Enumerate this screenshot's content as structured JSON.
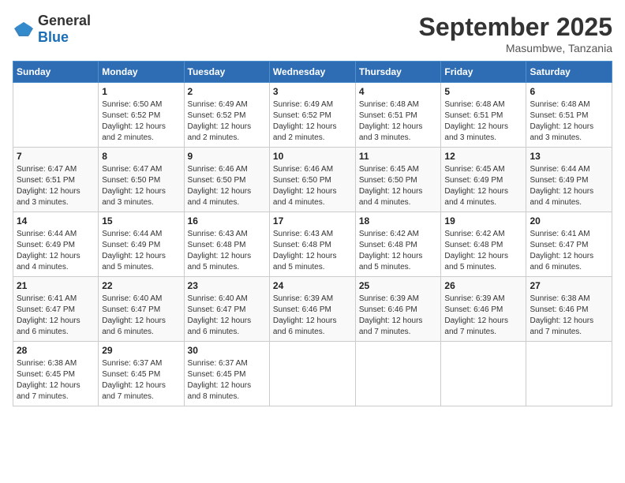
{
  "logo": {
    "general": "General",
    "blue": "Blue"
  },
  "header": {
    "month": "September 2025",
    "location": "Masumbwe, Tanzania"
  },
  "weekdays": [
    "Sunday",
    "Monday",
    "Tuesday",
    "Wednesday",
    "Thursday",
    "Friday",
    "Saturday"
  ],
  "weeks": [
    [
      {
        "day": "",
        "info": ""
      },
      {
        "day": "1",
        "info": "Sunrise: 6:50 AM\nSunset: 6:52 PM\nDaylight: 12 hours\nand 2 minutes."
      },
      {
        "day": "2",
        "info": "Sunrise: 6:49 AM\nSunset: 6:52 PM\nDaylight: 12 hours\nand 2 minutes."
      },
      {
        "day": "3",
        "info": "Sunrise: 6:49 AM\nSunset: 6:52 PM\nDaylight: 12 hours\nand 2 minutes."
      },
      {
        "day": "4",
        "info": "Sunrise: 6:48 AM\nSunset: 6:51 PM\nDaylight: 12 hours\nand 3 minutes."
      },
      {
        "day": "5",
        "info": "Sunrise: 6:48 AM\nSunset: 6:51 PM\nDaylight: 12 hours\nand 3 minutes."
      },
      {
        "day": "6",
        "info": "Sunrise: 6:48 AM\nSunset: 6:51 PM\nDaylight: 12 hours\nand 3 minutes."
      }
    ],
    [
      {
        "day": "7",
        "info": "Sunrise: 6:47 AM\nSunset: 6:51 PM\nDaylight: 12 hours\nand 3 minutes."
      },
      {
        "day": "8",
        "info": "Sunrise: 6:47 AM\nSunset: 6:50 PM\nDaylight: 12 hours\nand 3 minutes."
      },
      {
        "day": "9",
        "info": "Sunrise: 6:46 AM\nSunset: 6:50 PM\nDaylight: 12 hours\nand 4 minutes."
      },
      {
        "day": "10",
        "info": "Sunrise: 6:46 AM\nSunset: 6:50 PM\nDaylight: 12 hours\nand 4 minutes."
      },
      {
        "day": "11",
        "info": "Sunrise: 6:45 AM\nSunset: 6:50 PM\nDaylight: 12 hours\nand 4 minutes."
      },
      {
        "day": "12",
        "info": "Sunrise: 6:45 AM\nSunset: 6:49 PM\nDaylight: 12 hours\nand 4 minutes."
      },
      {
        "day": "13",
        "info": "Sunrise: 6:44 AM\nSunset: 6:49 PM\nDaylight: 12 hours\nand 4 minutes."
      }
    ],
    [
      {
        "day": "14",
        "info": "Sunrise: 6:44 AM\nSunset: 6:49 PM\nDaylight: 12 hours\nand 4 minutes."
      },
      {
        "day": "15",
        "info": "Sunrise: 6:44 AM\nSunset: 6:49 PM\nDaylight: 12 hours\nand 5 minutes."
      },
      {
        "day": "16",
        "info": "Sunrise: 6:43 AM\nSunset: 6:48 PM\nDaylight: 12 hours\nand 5 minutes."
      },
      {
        "day": "17",
        "info": "Sunrise: 6:43 AM\nSunset: 6:48 PM\nDaylight: 12 hours\nand 5 minutes."
      },
      {
        "day": "18",
        "info": "Sunrise: 6:42 AM\nSunset: 6:48 PM\nDaylight: 12 hours\nand 5 minutes."
      },
      {
        "day": "19",
        "info": "Sunrise: 6:42 AM\nSunset: 6:48 PM\nDaylight: 12 hours\nand 5 minutes."
      },
      {
        "day": "20",
        "info": "Sunrise: 6:41 AM\nSunset: 6:47 PM\nDaylight: 12 hours\nand 6 minutes."
      }
    ],
    [
      {
        "day": "21",
        "info": "Sunrise: 6:41 AM\nSunset: 6:47 PM\nDaylight: 12 hours\nand 6 minutes."
      },
      {
        "day": "22",
        "info": "Sunrise: 6:40 AM\nSunset: 6:47 PM\nDaylight: 12 hours\nand 6 minutes."
      },
      {
        "day": "23",
        "info": "Sunrise: 6:40 AM\nSunset: 6:47 PM\nDaylight: 12 hours\nand 6 minutes."
      },
      {
        "day": "24",
        "info": "Sunrise: 6:39 AM\nSunset: 6:46 PM\nDaylight: 12 hours\nand 6 minutes."
      },
      {
        "day": "25",
        "info": "Sunrise: 6:39 AM\nSunset: 6:46 PM\nDaylight: 12 hours\nand 7 minutes."
      },
      {
        "day": "26",
        "info": "Sunrise: 6:39 AM\nSunset: 6:46 PM\nDaylight: 12 hours\nand 7 minutes."
      },
      {
        "day": "27",
        "info": "Sunrise: 6:38 AM\nSunset: 6:46 PM\nDaylight: 12 hours\nand 7 minutes."
      }
    ],
    [
      {
        "day": "28",
        "info": "Sunrise: 6:38 AM\nSunset: 6:45 PM\nDaylight: 12 hours\nand 7 minutes."
      },
      {
        "day": "29",
        "info": "Sunrise: 6:37 AM\nSunset: 6:45 PM\nDaylight: 12 hours\nand 7 minutes."
      },
      {
        "day": "30",
        "info": "Sunrise: 6:37 AM\nSunset: 6:45 PM\nDaylight: 12 hours\nand 8 minutes."
      },
      {
        "day": "",
        "info": ""
      },
      {
        "day": "",
        "info": ""
      },
      {
        "day": "",
        "info": ""
      },
      {
        "day": "",
        "info": ""
      }
    ]
  ]
}
